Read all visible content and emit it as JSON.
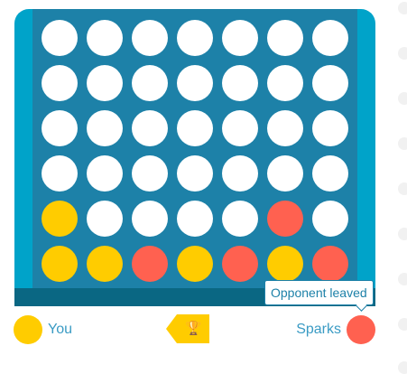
{
  "board": {
    "rows": 6,
    "columns": 7,
    "cells": [
      [
        "empty",
        "empty",
        "empty",
        "empty",
        "empty",
        "empty",
        "empty"
      ],
      [
        "empty",
        "empty",
        "empty",
        "empty",
        "empty",
        "empty",
        "empty"
      ],
      [
        "empty",
        "empty",
        "empty",
        "empty",
        "empty",
        "empty",
        "empty"
      ],
      [
        "empty",
        "empty",
        "empty",
        "empty",
        "empty",
        "empty",
        "empty"
      ],
      [
        "yellow",
        "empty",
        "empty",
        "empty",
        "empty",
        "red",
        "empty"
      ],
      [
        "yellow",
        "yellow",
        "red",
        "yellow",
        "red",
        "yellow",
        "red"
      ]
    ]
  },
  "players": {
    "you": {
      "name": "You",
      "color": "#ffcc00"
    },
    "opponent": {
      "name": "Sparks",
      "color": "#ff6150"
    }
  },
  "status": {
    "tooltip": "Opponent leaved",
    "turn_indicator_icon": "trophy-icon"
  },
  "colors": {
    "board": "#1d81a8",
    "board_frame": "#00a3c9",
    "board_base": "#0a6783",
    "yellow": "#ffcc00",
    "red": "#ff6150",
    "empty": "#ffffff"
  }
}
